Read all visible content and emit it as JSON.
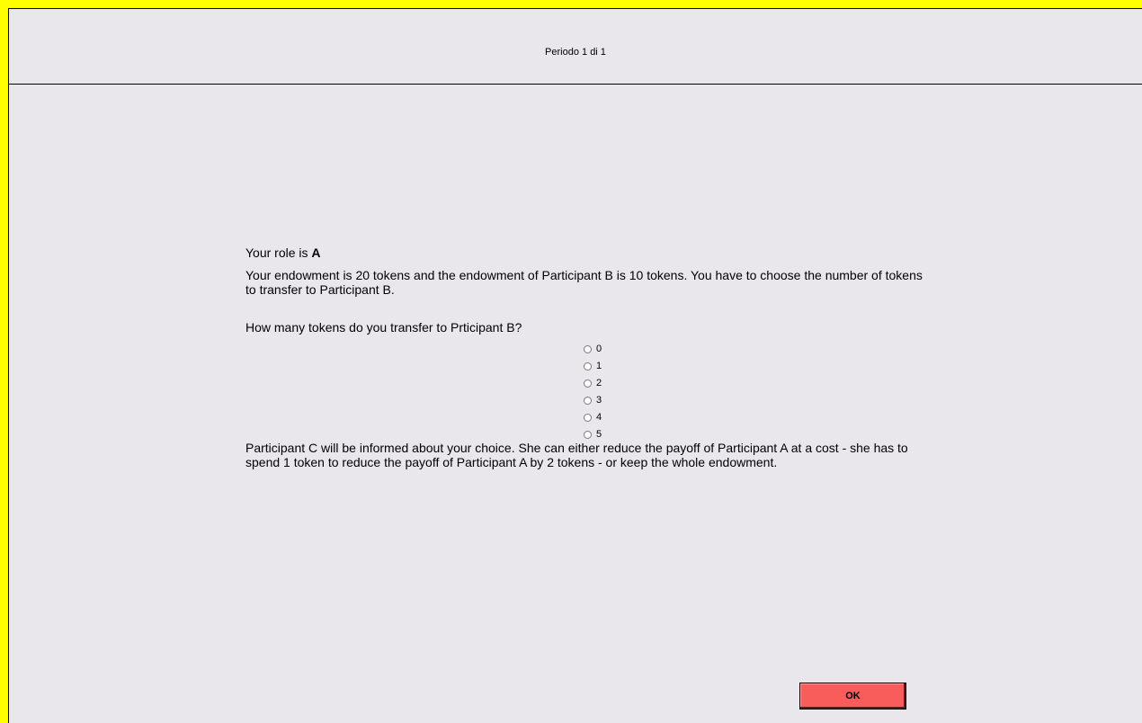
{
  "header": {
    "period_label": "Periodo 1 di 1"
  },
  "main": {
    "role_prefix": "Your role is ",
    "role_value": "A",
    "endowment_text": "Your endowment is 20 tokens and the endowment of Participant B is  10 tokens. You have to choose the number of tokens to transfer to Participant B.",
    "question_text": "How many tokens do you transfer to Prticipant B?",
    "options": [
      "0",
      "1",
      "2",
      "3",
      "4",
      "5"
    ],
    "info_text": "Participant C will be informed about your choice. She can either reduce the payoff of Participant A at a cost - she has to spend 1 token to reduce the payoff of Participant A by 2 tokens - or keep the whole endowment."
  },
  "footer": {
    "ok_label": "OK"
  },
  "colors": {
    "outer_border": "#ffff00",
    "background": "#eae7ec",
    "ok_button": "#f85d5b"
  }
}
